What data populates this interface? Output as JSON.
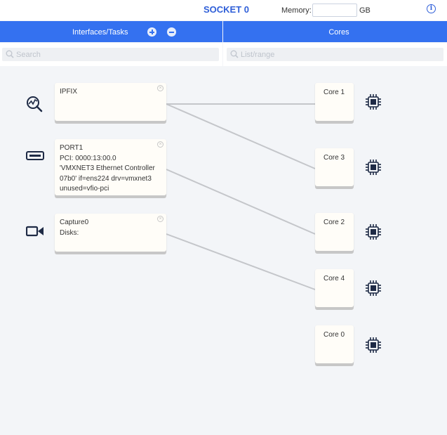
{
  "header": {
    "title": "SOCKET 0",
    "memory_label": "Memory:",
    "memory_value": "",
    "memory_unit": "GB",
    "info_icon": "info-icon"
  },
  "left_column": {
    "title": "Interfaces/Tasks",
    "add_icon": "plus-circle-icon",
    "remove_icon": "minus-circle-icon",
    "search_placeholder": "Search"
  },
  "right_column": {
    "title": "Cores",
    "search_placeholder": "List/range"
  },
  "tasks": [
    {
      "icon": "ipfix-analytics-icon",
      "lines": [
        "IPFIX"
      ]
    },
    {
      "icon": "network-port-icon",
      "lines": [
        "PORT1",
        "PCI: 0000:13:00.0",
        "'VMXNET3 Ethernet Controller",
        "07b0' if=ens224 drv=vmxnet3",
        "unused=vfio-pci"
      ]
    },
    {
      "icon": "video-camera-icon",
      "lines": [
        "Capture0",
        "Disks:"
      ]
    }
  ],
  "cores": [
    {
      "label": "Core 1",
      "icon": "cpu-chip-icon"
    },
    {
      "label": "Core 3",
      "icon": "cpu-chip-icon"
    },
    {
      "label": "Core 2",
      "icon": "cpu-chip-icon"
    },
    {
      "label": "Core 4",
      "icon": "cpu-chip-icon"
    },
    {
      "label": "Core 0",
      "icon": "cpu-chip-icon"
    }
  ],
  "connections": [
    {
      "task": "IPFIX",
      "core": "Core 1"
    },
    {
      "task": "IPFIX",
      "core": "Core 3"
    },
    {
      "task": "PORT1",
      "core": "Core 2"
    },
    {
      "task": "Capture0",
      "core": "Core 4"
    }
  ],
  "colors": {
    "accent": "#3471f0",
    "title": "#2f5fd8",
    "background": "#f3f5f8",
    "card": "#fffdf8",
    "connector": "#c4c6ca",
    "icon": "#1e2a45"
  }
}
